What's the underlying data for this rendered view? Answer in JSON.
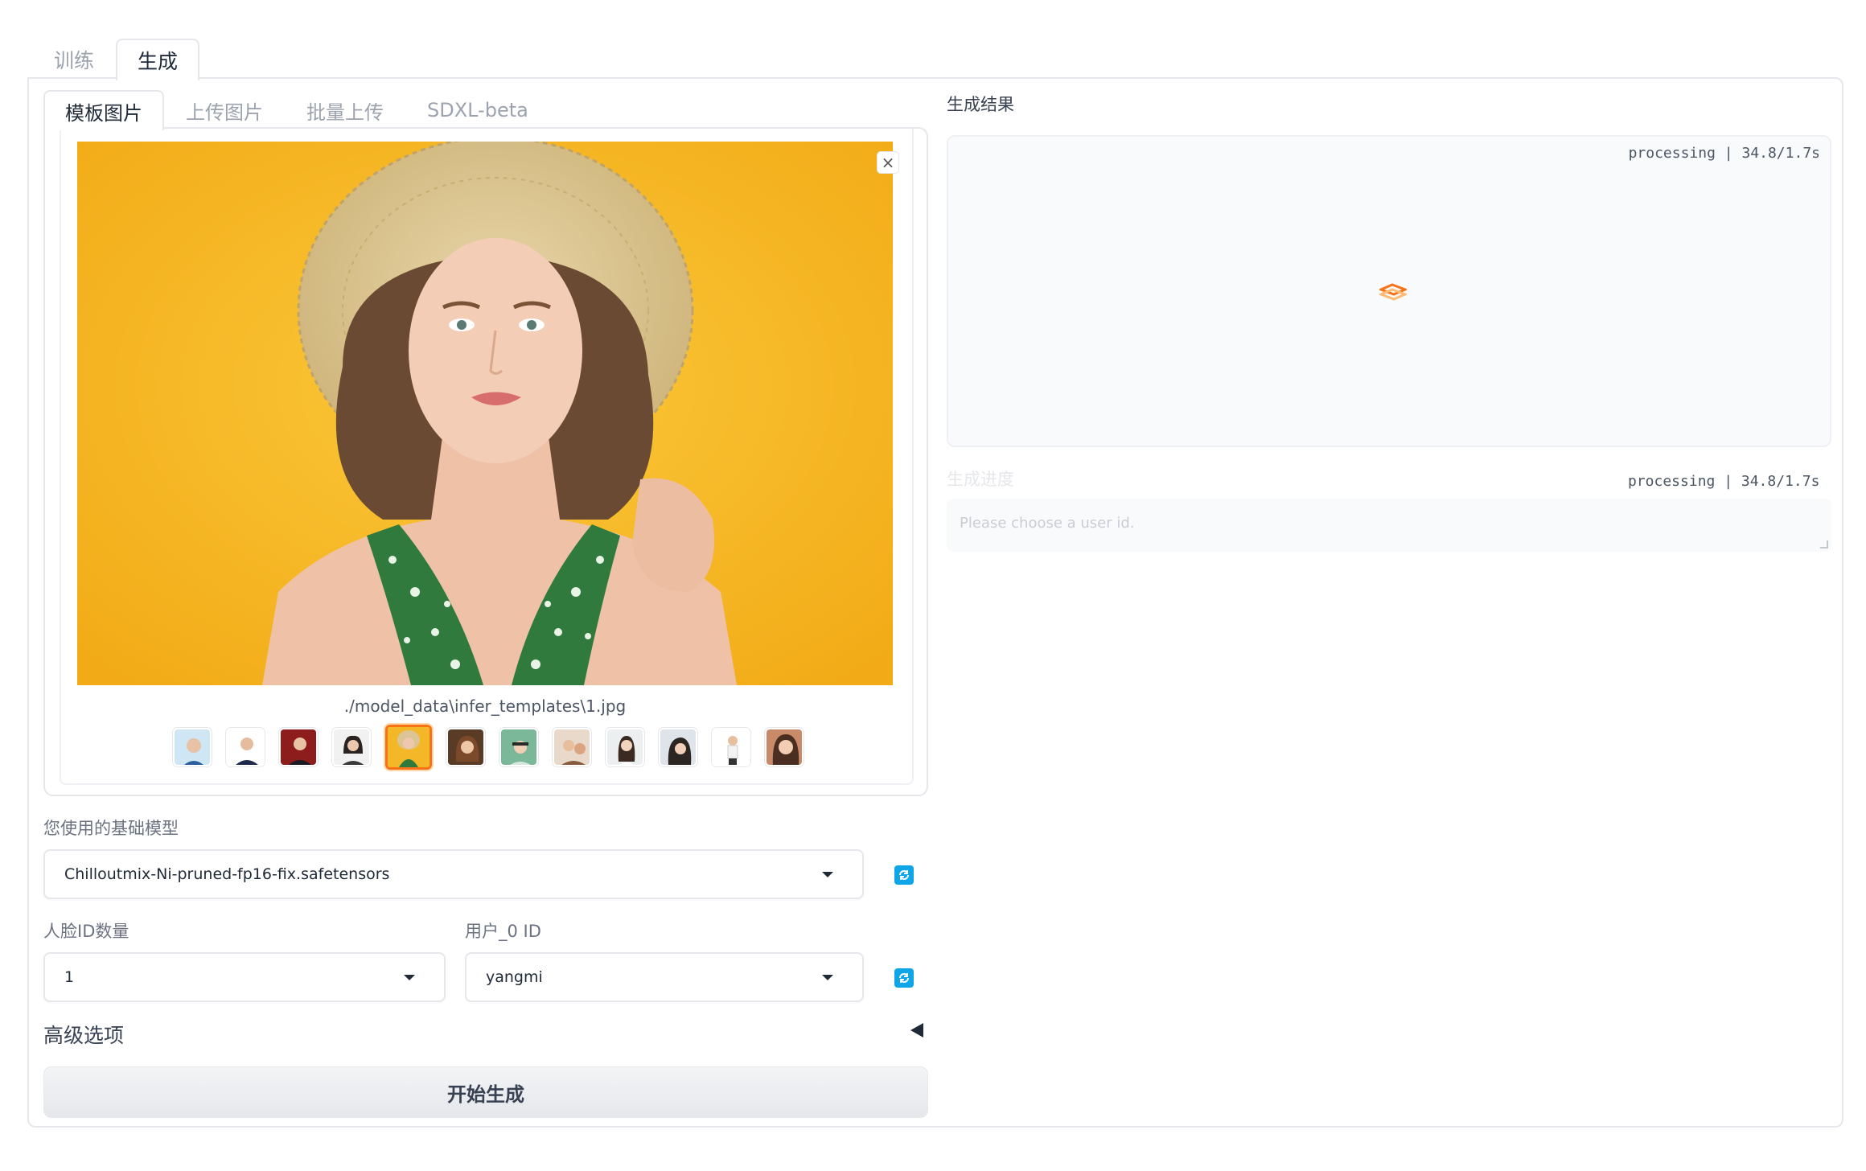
{
  "main_tabs": [
    {
      "label": "训练",
      "active": false
    },
    {
      "label": "生成",
      "active": true
    }
  ],
  "sub_tabs": [
    {
      "label": "模板图片",
      "active": true
    },
    {
      "label": "上传图片",
      "active": false
    },
    {
      "label": "批量上传",
      "active": false
    },
    {
      "label": "SDXL-beta",
      "active": false
    }
  ],
  "gallery": {
    "caption": "./model_data\\infer_templates\\1.jpg",
    "thumbnail_count": 12,
    "selected_index": 4
  },
  "base_model": {
    "label": "您使用的基础模型",
    "value": "Chilloutmix-Ni-pruned-fp16-fix.safetensors"
  },
  "face_id_count": {
    "label": "人脸ID数量",
    "value": "1"
  },
  "user_id": {
    "label": "用户_0 ID",
    "value": "yangmi"
  },
  "advanced": {
    "label": "高级选项"
  },
  "generate_button": {
    "label": "开始生成"
  },
  "result": {
    "label": "生成结果",
    "status": "processing | 34.8/1.7s"
  },
  "progress": {
    "label": "生成进度",
    "status": "processing | 34.8/1.7s",
    "placeholder": "Please choose a user id."
  },
  "colors": {
    "accent": "#f97316",
    "refresh": "#0ea5e9",
    "preview_background": "#f4b728"
  }
}
